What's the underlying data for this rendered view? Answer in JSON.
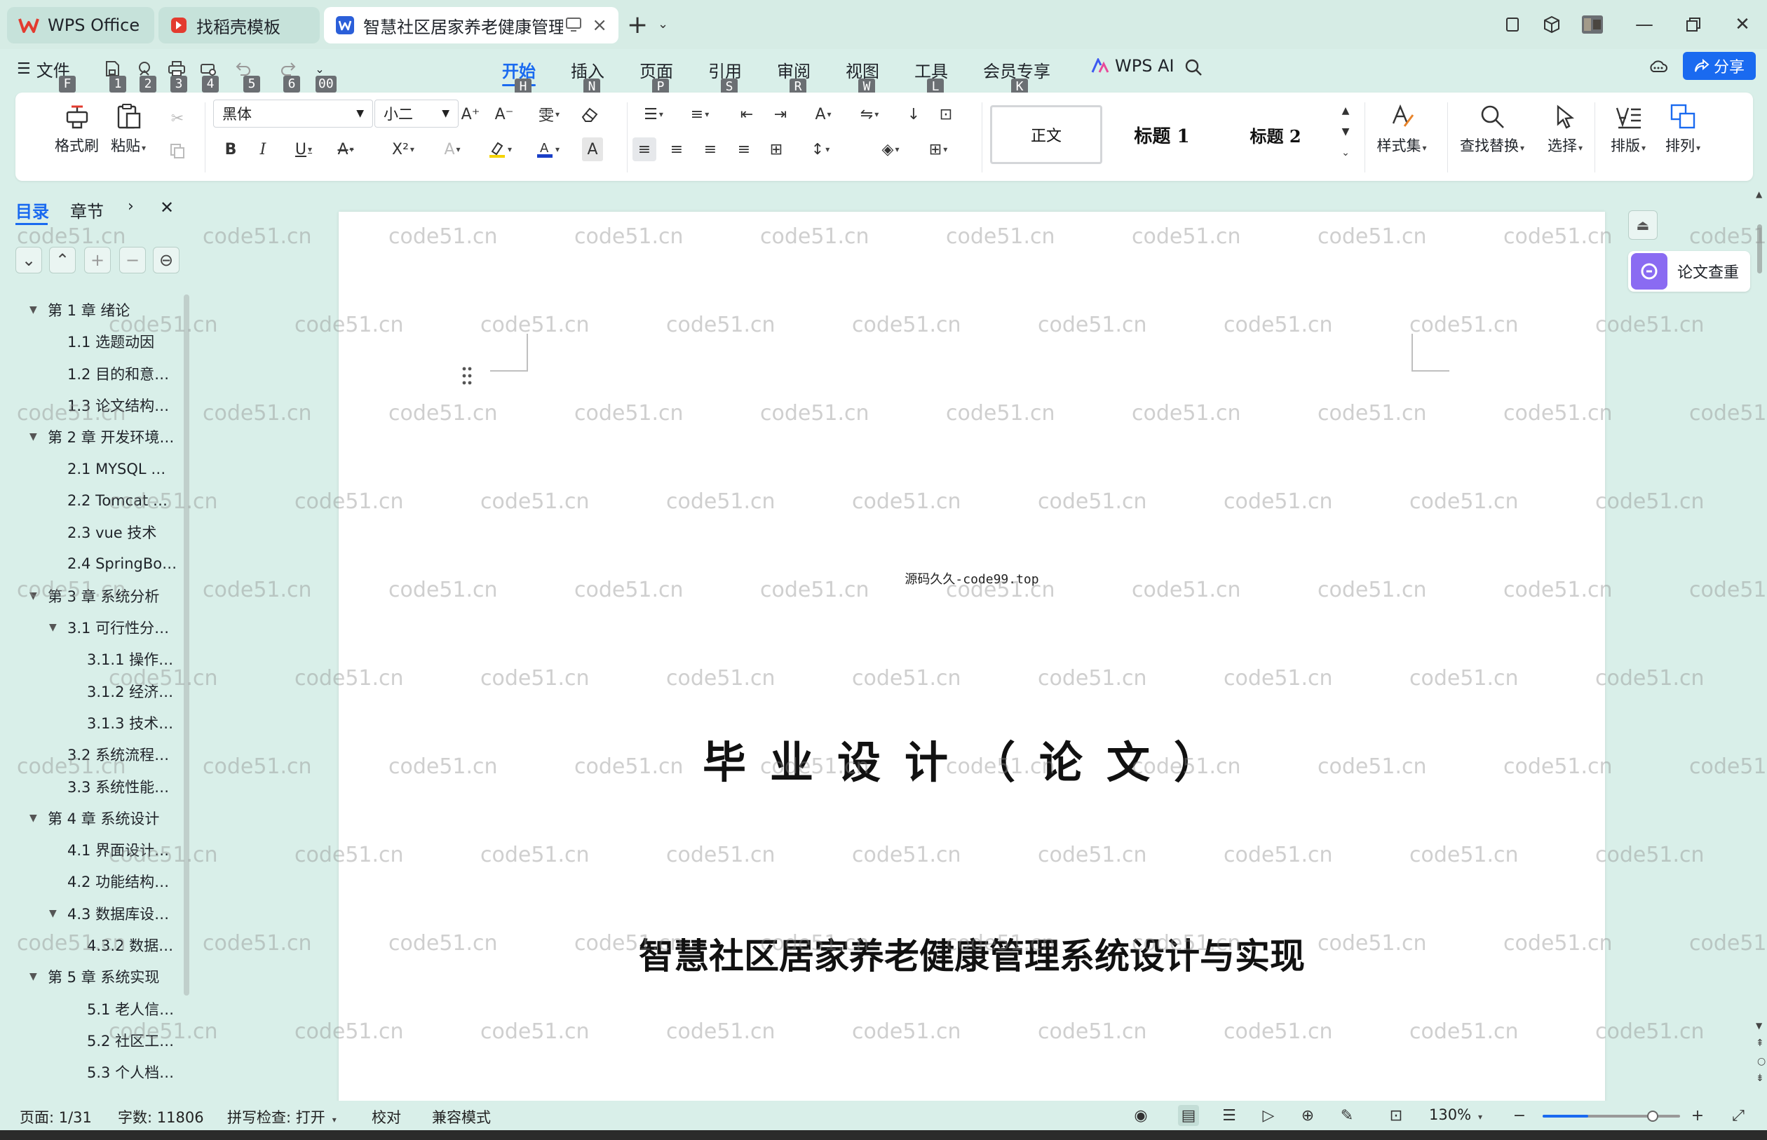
{
  "tabs": {
    "wps": "WPS Office",
    "docer": "找稻壳模板",
    "doc": "智慧社区居家养老健康管理系统设计与实现"
  },
  "menu": {
    "file": "文件",
    "file_key": "F",
    "qa_keys": [
      "1",
      "2",
      "3",
      "4",
      "5",
      "6",
      "00"
    ],
    "tabs": [
      {
        "label": "开始",
        "key": "H"
      },
      {
        "label": "插入",
        "key": "N"
      },
      {
        "label": "页面",
        "key": "P"
      },
      {
        "label": "引用",
        "key": "S"
      },
      {
        "label": "审阅",
        "key": "R"
      },
      {
        "label": "视图",
        "key": "W"
      },
      {
        "label": "工具",
        "key": "L"
      },
      {
        "label": "会员专享",
        "key": "K"
      }
    ],
    "wps_ai": "WPS AI",
    "share": "分享"
  },
  "ribbon": {
    "format_painter": "格式刷",
    "paste": "粘贴",
    "font_name": "黑体",
    "font_size": "小二",
    "style_normal": "正文",
    "style_h1": "标题 1",
    "style_h2": "标题 2",
    "style_set": "样式集",
    "find_replace": "查找替换",
    "select": "选择",
    "layout": "排版",
    "arrange": "排列"
  },
  "nav": {
    "tab_toc": "目录",
    "tab_section": "章节",
    "items": [
      {
        "label": "第 1 章  绪论",
        "level": 1
      },
      {
        "label": "1.1 选题动因",
        "level": 2
      },
      {
        "label": "1.2 目的和意…",
        "level": 2
      },
      {
        "label": "1.3 论文结构…",
        "level": 2
      },
      {
        "label": "第 2 章  开发环境…",
        "level": 1
      },
      {
        "label": "2.1 MYSQL …",
        "level": 2
      },
      {
        "label": "2.2 Tomcat …",
        "level": 2
      },
      {
        "label": "2.3 vue 技术",
        "level": 2
      },
      {
        "label": "2.4 SpringBo…",
        "level": 2
      },
      {
        "label": "第 3 章  系统分析",
        "level": 1
      },
      {
        "label": "3.1 可行性分…",
        "level": 2
      },
      {
        "label": "3.1.1 操作…",
        "level": 3
      },
      {
        "label": "3.1.2 经济…",
        "level": 3
      },
      {
        "label": "3.1.3 技术…",
        "level": 3
      },
      {
        "label": "3.2 系统流程…",
        "level": 2
      },
      {
        "label": "3.3 系统性能…",
        "level": 2
      },
      {
        "label": "第 4 章  系统设计",
        "level": 1
      },
      {
        "label": "4.1 界面设计…",
        "level": 2
      },
      {
        "label": "4.2 功能结构…",
        "level": 2
      },
      {
        "label": "4.3 数据库设…",
        "level": 2
      },
      {
        "label": "4.3.2 数据…",
        "level": 3
      },
      {
        "label": "第 5 章  系统实现",
        "level": 1
      },
      {
        "label": "5.1 老人信…",
        "level": 3
      },
      {
        "label": "5.2 社区工…",
        "level": 3
      },
      {
        "label": "5.3 个人档…",
        "level": 3
      }
    ]
  },
  "document": {
    "source_line": "源码久久-code99.top",
    "title": "毕业设计（论文）",
    "subtitle": "智慧社区居家养老健康管理系统设计与实现",
    "side_check": "论文查重"
  },
  "watermark": "code51.cn",
  "status": {
    "page": "页面: 1/31",
    "words": "字数: 11806",
    "spell": "拼写检查: 打开",
    "proof": "校对",
    "compat": "兼容模式",
    "zoom": "130%",
    "zoom_fraction": 0.33
  },
  "colors": {
    "accent": "#1a6af0",
    "wps_red": "#e33b2f",
    "word_blue": "#2b5fd9",
    "check_purple": "#8a6bf2"
  }
}
